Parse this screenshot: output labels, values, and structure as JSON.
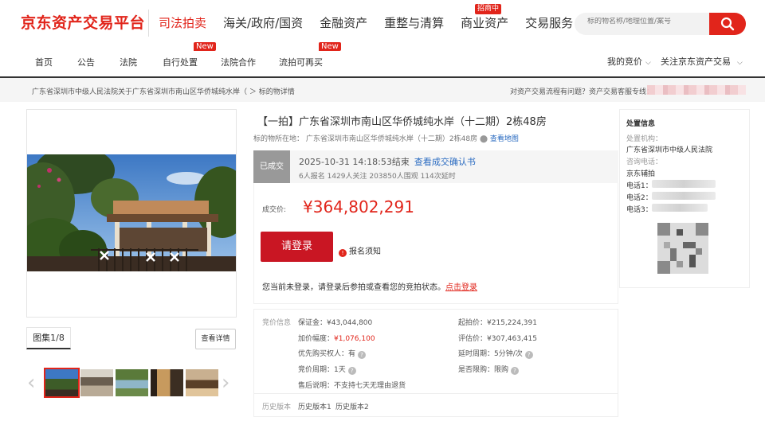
{
  "header": {
    "logo": "京东资产交易平台",
    "nav": [
      "司法拍卖",
      "海关/政府/国资",
      "金融资产",
      "重整与清算",
      "商业资产",
      "交易服务"
    ],
    "nav_badge": "招商中",
    "search_placeholder": "标的物名称/地理位置/案号"
  },
  "subnav": {
    "items": [
      "首页",
      "公告",
      "法院",
      "自行处置",
      "法院合作",
      "流拍可再买"
    ],
    "new_badge": "New",
    "my_auction": "我的竞价",
    "follow": "关注京东资产交易"
  },
  "breadcrumb": {
    "text": "广东省深圳市中级人民法院关于广东省深圳市南山区华侨城纯水岸（ ＞ 标的物详情",
    "help": "对资产交易流程有问题？资产交易客服专线："
  },
  "gallery": {
    "album_label": "图集1/8",
    "detail_button": "查看详情",
    "left_arrow": "‹",
    "right_arrow": "›"
  },
  "lot": {
    "title": "【一拍】广东省深圳市南山区华侨城纯水岸（十二期）2栋48房",
    "location_label": "标的物所在地：",
    "location": "广东省深圳市南山区华侨城纯水岸（十二期）2栋48房",
    "map_link": "查看地图",
    "status": "已成交",
    "end_time": "2025-10-31 14:18:53结束",
    "confirm_link": "查看成交确认书",
    "stats": "6人报名  1429人关注  203850人围观  114次延时",
    "price_label": "成交价:",
    "price": "¥364,802,291",
    "login_button": "请登录",
    "notice": "报名须知",
    "login_hint": "您当前未登录，请登录后参拍或查看您的竞拍状态。",
    "login_link": "点击登录"
  },
  "bid_info": {
    "section_label": "竞价信息",
    "deposit": "保证金：¥43,044,800",
    "increment_label": "加价幅度：",
    "increment": "¥1,076,100",
    "priority": "优先购买权人：有",
    "cycle": "竞价周期：1天",
    "after_sale": "售后说明：不支持七天无理由退货",
    "start_price": "起拍价：¥215,224,391",
    "valuation": "评估价：¥307,463,415",
    "delay": "延时周期：5分钟/次",
    "limit": "是否限购：限购",
    "history_label": "历史版本",
    "history_1": "历史版本1",
    "history_2": "历史版本2"
  },
  "disposal": {
    "title": "处置信息",
    "org_label": "处置机构：",
    "org": "广东省深圳市中级人民法院",
    "phone_label": "咨询电话：",
    "assist": "京东辅拍",
    "phone1": "电话1：",
    "phone2": "电话2：",
    "phone3": "电话3："
  },
  "colors": {
    "brand": "#e1251b",
    "button": "#c91623",
    "link": "#2a6bc1"
  }
}
